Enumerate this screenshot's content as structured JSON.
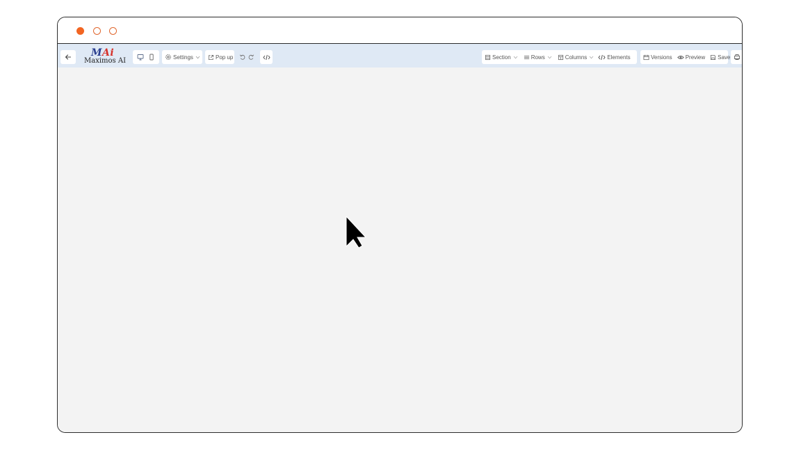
{
  "logo": {
    "mark_left": "M",
    "mark_right": "Ai",
    "text": "Maximos AI"
  },
  "toolbar": {
    "left": {
      "back_icon": "arrow-left-icon",
      "desktop_icon": "monitor-icon",
      "mobile_icon": "smartphone-icon",
      "settings_label": "Settings",
      "popup_label": "Pop up",
      "undo_icon": "undo-icon",
      "redo_icon": "redo-icon",
      "code_icon": "code-icon"
    },
    "right": {
      "section_label": "Section",
      "rows_label": "Rows",
      "columns_label": "Columns",
      "elements_label": "Elements",
      "versions_label": "Versions",
      "preview_label": "Preview",
      "save_label": "Save",
      "print_icon": "printer-icon"
    }
  },
  "colors": {
    "toolbar_bg": "#dfe9f5",
    "canvas_bg": "#f3f3f3",
    "traffic_light": "#f26522",
    "logo_blue": "#2b3f8f",
    "logo_red": "#d6322b"
  }
}
